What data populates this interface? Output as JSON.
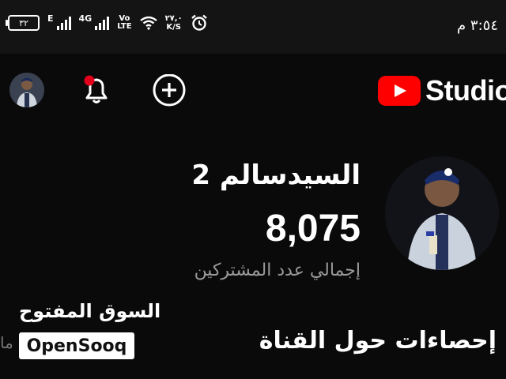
{
  "status_bar": {
    "battery": "٣٢",
    "network_e": "E",
    "network_4g": "4G",
    "volte_top": "Vo",
    "volte_bottom": "LTE",
    "speed_top": "٢٧,٠",
    "speed_bottom": "K/S",
    "time": "٣:٥٤ م"
  },
  "app_bar": {
    "logo_text": "Studio",
    "brand_red": "#ff0000",
    "notification_dot": "#e0001b",
    "icons": [
      "account-avatar",
      "bell-icon",
      "add-circle-icon"
    ]
  },
  "channel": {
    "name": "السيدسالم 2",
    "subscriber_count": "8,075",
    "subscriber_label": "إجمالي عدد المشتركين"
  },
  "section": {
    "title": "إحصاءات حول القناة",
    "partial_left": "ما"
  },
  "watermark": {
    "arabic": "السوق المفتوح",
    "latin": "OpenSooq"
  }
}
